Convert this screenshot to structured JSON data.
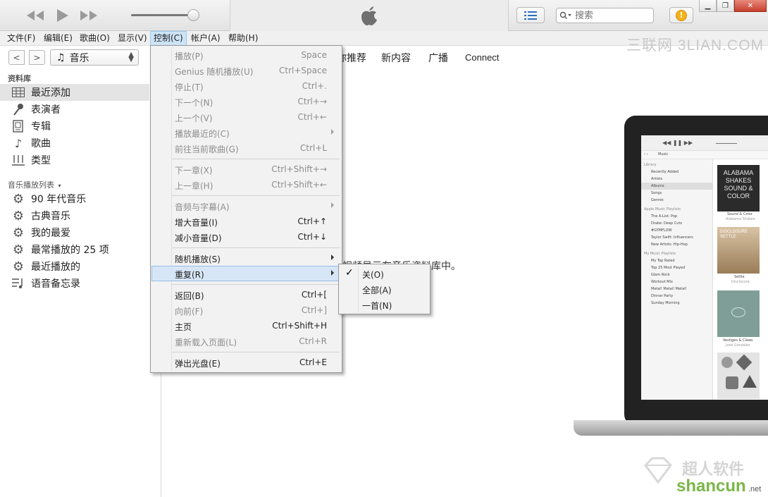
{
  "window": {
    "title_logo": "apple-logo",
    "controls": [
      "minimize",
      "restore",
      "close"
    ]
  },
  "player": {
    "volume_fraction": 0.92
  },
  "search": {
    "placeholder": "搜索"
  },
  "menubar": {
    "items": [
      {
        "label": "文件(F)"
      },
      {
        "label": "编辑(E)"
      },
      {
        "label": "歌曲(O)"
      },
      {
        "label": "显示(V)"
      },
      {
        "label": "控制(C)"
      },
      {
        "label": "帐户(A)"
      },
      {
        "label": "帮助(H)"
      }
    ],
    "active_index": 4
  },
  "nav": {
    "back": "<",
    "forward": ">",
    "media_kind": "音乐"
  },
  "tabs": [
    {
      "label": "为你推荐"
    },
    {
      "label": "新内容"
    },
    {
      "label": "广播"
    },
    {
      "label": "Connect"
    }
  ],
  "sidebar": {
    "library_header": "资料库",
    "library": [
      {
        "label": "最近添加",
        "icon": "grid-icon"
      },
      {
        "label": "表演者",
        "icon": "microphone-icon"
      },
      {
        "label": "专辑",
        "icon": "album-icon"
      },
      {
        "label": "歌曲",
        "icon": "music-note-icon"
      },
      {
        "label": "类型",
        "icon": "genre-icon"
      }
    ],
    "playlists_header": "音乐播放列表",
    "playlists": [
      {
        "label": "90 年代音乐",
        "icon": "gear-icon"
      },
      {
        "label": "古典音乐",
        "icon": "gear-icon"
      },
      {
        "label": "我的最爱",
        "icon": "gear-icon"
      },
      {
        "label": "最常播放的 25 项",
        "icon": "gear-icon"
      },
      {
        "label": "最近播放的",
        "icon": "gear-icon"
      },
      {
        "label": "语音备忘录",
        "icon": "playlist-icon"
      }
    ]
  },
  "control_menu": {
    "items": [
      {
        "label": "播放(P)",
        "shortcut": "Space",
        "enabled": false
      },
      {
        "label": "Genius 随机播放(U)",
        "shortcut": "Ctrl+Space",
        "enabled": false
      },
      {
        "label": "停止(T)",
        "shortcut": "Ctrl+.",
        "enabled": false
      },
      {
        "label": "下一个(N)",
        "shortcut": "Ctrl+→",
        "enabled": false
      },
      {
        "label": "上一个(V)",
        "shortcut": "Ctrl+←",
        "enabled": false
      },
      {
        "label": "播放最近的(C)",
        "shortcut": "",
        "enabled": false,
        "submenu": true
      },
      {
        "label": "前往当前歌曲(G)",
        "shortcut": "Ctrl+L",
        "enabled": false
      },
      {
        "label": "下一章(X)",
        "shortcut": "Ctrl+Shift+→",
        "enabled": false
      },
      {
        "label": "上一章(H)",
        "shortcut": "Ctrl+Shift+←",
        "enabled": false
      },
      {
        "label": "音频与字幕(A)",
        "shortcut": "",
        "enabled": false,
        "submenu": true
      },
      {
        "label": "增大音量(I)",
        "shortcut": "Ctrl+↑",
        "enabled": true
      },
      {
        "label": "减小音量(D)",
        "shortcut": "Ctrl+↓",
        "enabled": true
      },
      {
        "label": "随机播放(S)",
        "shortcut": "",
        "enabled": true,
        "submenu": true
      },
      {
        "label": "重复(R)",
        "shortcut": "",
        "enabled": true,
        "submenu": true,
        "highlighted": true
      },
      {
        "label": "返回(B)",
        "shortcut": "Ctrl+[",
        "enabled": true
      },
      {
        "label": "向前(F)",
        "shortcut": "Ctrl+]",
        "enabled": false
      },
      {
        "label": "主页",
        "shortcut": "Ctrl+Shift+H",
        "enabled": true
      },
      {
        "label": "重新载入页面(L)",
        "shortcut": "Ctrl+R",
        "enabled": false
      },
      {
        "label": "弹出光盘(E)",
        "shortcut": "Ctrl+E",
        "enabled": true
      }
    ]
  },
  "repeat_submenu": {
    "items": [
      {
        "label": "关(O)",
        "checked": true
      },
      {
        "label": "全部(A)",
        "checked": false
      },
      {
        "label": "一首(N)",
        "checked": false
      }
    ]
  },
  "content": {
    "info_text": "视频显示在音乐资料库中。"
  },
  "laptop_preview": {
    "media_kind": "Music",
    "library_header": "Library",
    "library": [
      "Recently Added",
      "Artists",
      "Albums",
      "Songs",
      "Genres"
    ],
    "apple_playlists_header": "Apple Music Playlists",
    "apple_playlists": [
      "The A-List: Pop",
      "Drake: Deep Cuts",
      "#GYMFLOW",
      "Taylor Swift: Influencers",
      "New Artists: Hip-Hop"
    ],
    "my_playlists_header": "My Music Playlists",
    "my_playlists": [
      "My Top Rated",
      "Top 25 Most Played",
      "Glam Rock",
      "Workout Mix",
      "Metal! Metal! Metal!",
      "Dinner Party",
      "Sunday Morning"
    ],
    "albums": [
      {
        "title": "Sound & Color",
        "artist": "Alabama Shakes",
        "art_text": "ALABAMA SHAKES SOUND & COLOR"
      },
      {
        "title": "Settle",
        "artist": "Disclosure",
        "art_text": "DISCLOSURE SETTLE"
      },
      {
        "title": "Vestiges & Claws",
        "artist": "José González",
        "art_text": ""
      }
    ]
  },
  "watermarks": {
    "top": "三联网 3LIAN.COM",
    "bottom_cn": "超人软件",
    "bottom_en": "shancun",
    "bottom_net": ".net"
  }
}
